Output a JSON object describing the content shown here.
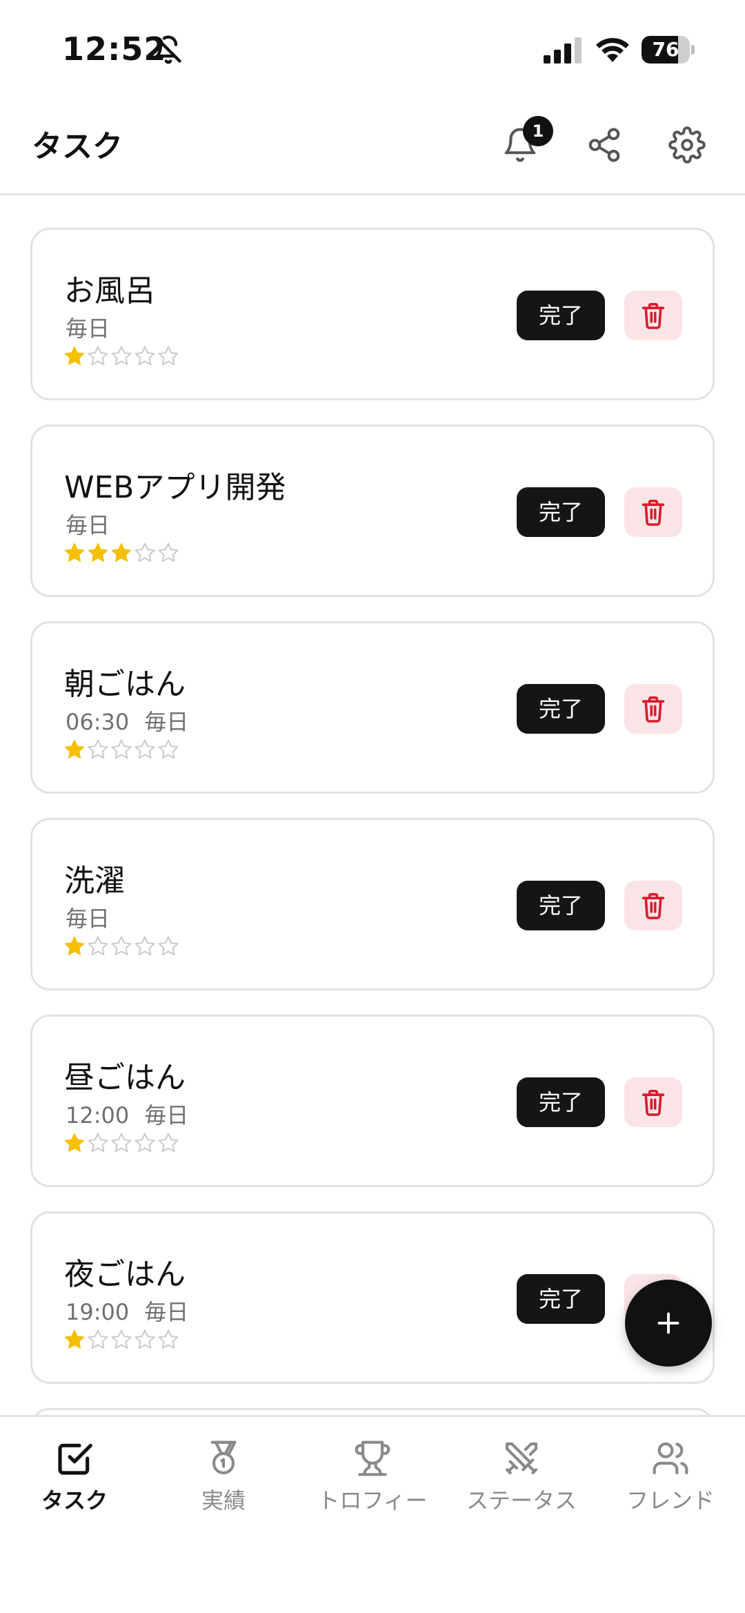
{
  "status_bar": {
    "time": "12:52",
    "battery": "76",
    "battery_level": 0.76
  },
  "header": {
    "title": "タスク",
    "notification_count": "1"
  },
  "tasks": [
    {
      "title": "お風呂",
      "time": "",
      "frequency": "毎日",
      "stars": 1,
      "complete_label": "完了"
    },
    {
      "title": "WEBアプリ開発",
      "time": "",
      "frequency": "毎日",
      "stars": 3,
      "complete_label": "完了"
    },
    {
      "title": "朝ごはん",
      "time": "06:30",
      "frequency": "毎日",
      "stars": 1,
      "complete_label": "完了"
    },
    {
      "title": "洗濯",
      "time": "",
      "frequency": "毎日",
      "stars": 1,
      "complete_label": "完了"
    },
    {
      "title": "昼ごはん",
      "time": "12:00",
      "frequency": "毎日",
      "stars": 1,
      "complete_label": "完了"
    },
    {
      "title": "夜ごはん",
      "time": "19:00",
      "frequency": "毎日",
      "stars": 1,
      "complete_label": "完了"
    }
  ],
  "max_stars": 5,
  "nav": {
    "items": [
      {
        "label": "タスク",
        "icon": "checkbox-icon",
        "active": true
      },
      {
        "label": "実績",
        "icon": "medal-icon",
        "active": false
      },
      {
        "label": "トロフィー",
        "icon": "trophy-icon",
        "active": false
      },
      {
        "label": "ステータス",
        "icon": "swords-icon",
        "active": false
      },
      {
        "label": "フレンド",
        "icon": "users-icon",
        "active": false
      }
    ]
  },
  "colors": {
    "accent": "#151515",
    "star_filled": "#f5c000",
    "star_empty": "#c9c9c9",
    "delete_bg": "#fbe4e6",
    "delete_icon": "#d81b2c"
  }
}
